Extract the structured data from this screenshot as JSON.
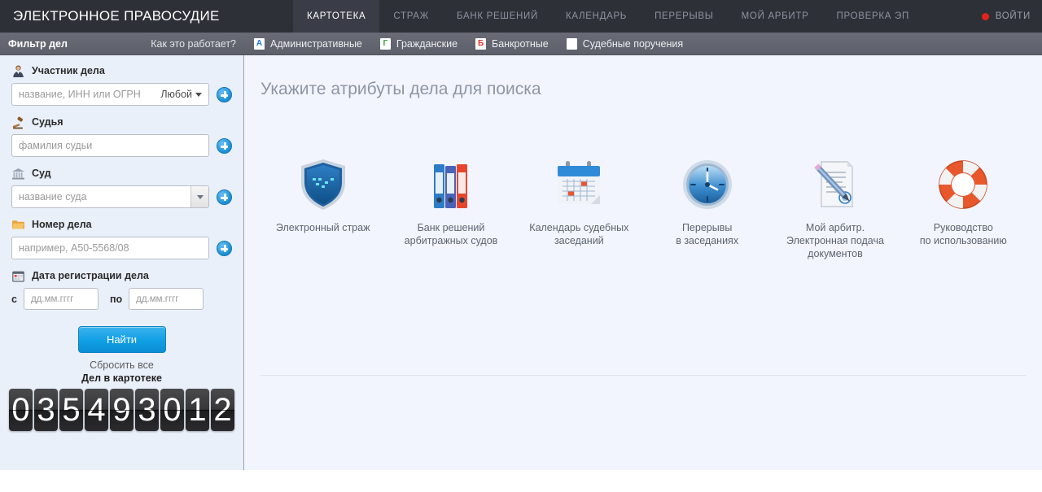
{
  "header": {
    "brand": "ЭЛЕКТРОННОЕ ПРАВОСУДИЕ",
    "nav": [
      {
        "label": "КАРТОТЕКА",
        "active": true
      },
      {
        "label": "СТРАЖ",
        "active": false
      },
      {
        "label": "БАНК РЕШЕНИЙ",
        "active": false
      },
      {
        "label": "КАЛЕНДАРЬ",
        "active": false
      },
      {
        "label": "ПЕРЕРЫВЫ",
        "active": false
      },
      {
        "label": "МОЙ АРБИТР",
        "active": false
      },
      {
        "label": "ПРОВЕРКА ЭП",
        "active": false
      }
    ],
    "login_label": "ВОЙТИ",
    "login_dot_color": "#e0241c",
    "bar_color": "#2e3038",
    "active_tab_color": "#3a3d47"
  },
  "subbar": {
    "filter_title": "Фильтр дел",
    "how_it_works": "Как это работает?",
    "categories": [
      {
        "badge": "А",
        "label": "Административные",
        "badge_color": "#2277d6"
      },
      {
        "badge": "Г",
        "label": "Гражданские",
        "badge_color": "#3aa340"
      },
      {
        "badge": "Б",
        "label": "Банкротные",
        "badge_color": "#e03127"
      },
      {
        "badge": "",
        "label": "Судебные поручения",
        "badge_color": "#ffffff"
      }
    ]
  },
  "sidebar": {
    "participant": {
      "label": "Участник дела",
      "placeholder": "название, ИНН или ОГРН",
      "select_value": "Любой"
    },
    "judge": {
      "label": "Судья",
      "placeholder": "фамилия судьи"
    },
    "court": {
      "label": "Суд",
      "placeholder": "название суда"
    },
    "case_number": {
      "label": "Номер дела",
      "placeholder": "например, А50-5568/08"
    },
    "date": {
      "label": "Дата регистрации дела",
      "from_label": "с",
      "to_label": "по",
      "from_placeholder": "дд.мм.гггг",
      "to_placeholder": "дд.мм.гггг"
    },
    "find_button": "Найти",
    "reset_link": "Сбросить все",
    "counter_title": "Дел в картотеке",
    "counter_digits": [
      "0",
      "3",
      "5",
      "4",
      "9",
      "3",
      "0",
      "1",
      "2"
    ],
    "accent_color": "#109fe4",
    "background_color": "#eaf0fa"
  },
  "main": {
    "title": "Укажите атрибуты дела для поиска",
    "background_color": "#f2f5fd",
    "tiles": [
      {
        "icon": "shield-icon",
        "label": "Электронный страж"
      },
      {
        "icon": "binders-icon",
        "label": "Банк решений\nарбитражных судов"
      },
      {
        "icon": "calendar-icon",
        "label": "Календарь судебных\nзаседаний"
      },
      {
        "icon": "clock-icon",
        "label": "Перерывы\nв заседаниях"
      },
      {
        "icon": "document-pen-icon",
        "label": "Мой арбитр.\nЭлектронная подача\nдокументов"
      },
      {
        "icon": "lifebuoy-icon",
        "label": "Руководство\nпо использованию"
      }
    ]
  }
}
